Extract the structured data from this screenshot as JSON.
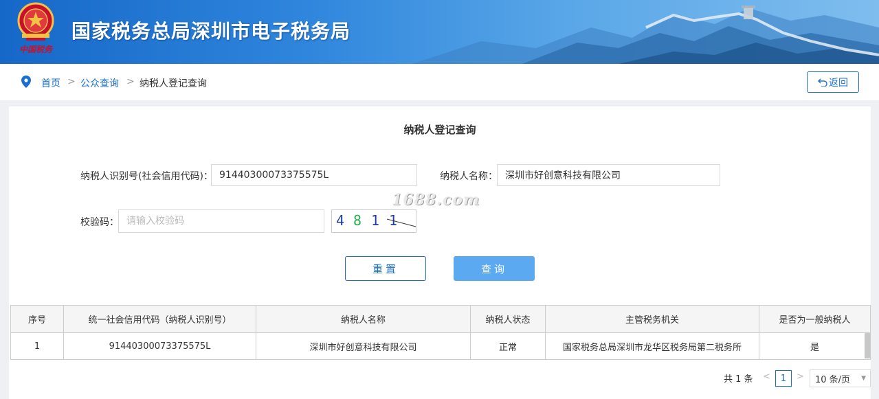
{
  "header": {
    "site_title": "国家税务总局深圳市电子税务局",
    "logo_text": "中国税务"
  },
  "breadcrumb": {
    "home": "首页",
    "sep1": ">",
    "public_query": "公众查询",
    "sep2": ">",
    "current": "纳税人登记查询",
    "back_label": "返回",
    "back_icon": "return-icon"
  },
  "form": {
    "title": "纳税人登记查询",
    "taxpayer_id_label": "纳税人识别号(社会信用代码)：",
    "taxpayer_id_value": "91440300073375575L",
    "taxpayer_name_label": "纳税人名称：",
    "taxpayer_name_value": "深圳市好创意科技有限公司",
    "captcha_label": "校验码：",
    "captcha_placeholder": "请输入校验码",
    "captcha_chars": [
      "4",
      "8",
      "1",
      "1"
    ],
    "watermark": "1688.com",
    "reset_label": "重置",
    "query_label": "查询"
  },
  "table": {
    "headers": [
      "序号",
      "统一社会信用代码（纳税人识别号）",
      "纳税人名称",
      "纳税人状态",
      "主管税务机关",
      "是否为一般纳税人"
    ],
    "rows": [
      [
        "1",
        "91440300073375575L",
        "深圳市好创意科技有限公司",
        "正常",
        "国家税务总局深圳市龙华区税务局第二税务所",
        "是"
      ]
    ]
  },
  "pager": {
    "total": "共 1 条",
    "prev": "<",
    "current_page": "1",
    "next": ">",
    "page_size": "10 条/页"
  },
  "colors": {
    "brand_blue": "#1b6fd0",
    "query_button": "#5aa9f1",
    "banner_start": "#1668c8",
    "banner_end": "#7fbdee"
  }
}
